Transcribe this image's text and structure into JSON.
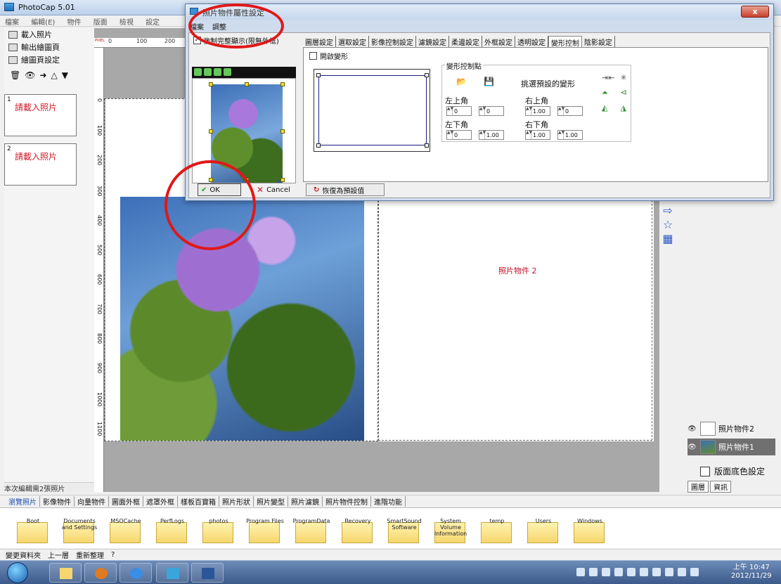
{
  "app": {
    "title": "PhotoCap 5.01"
  },
  "menu": {
    "items": [
      "檔案",
      "編輯(E)",
      "物件",
      "版面",
      "檢視",
      "設定"
    ]
  },
  "left": {
    "load_photo": "載入照片",
    "export_page": "輸出繪圖頁",
    "page_settings": "繪圖頁設定",
    "slots": [
      {
        "num": "1",
        "label": "請載入照片"
      },
      {
        "num": "2",
        "label": "請載入照片"
      }
    ],
    "status": "本次編輯需2張照片"
  },
  "canvas": {
    "ruler_units": "PIXEL",
    "h_ticks": [
      "0",
      "100",
      "200"
    ],
    "v_ticks": [
      "0",
      "100",
      "200",
      "300",
      "400",
      "500",
      "600",
      "700",
      "800",
      "900",
      "1000",
      "1100"
    ],
    "photo2_label": "照片物件 2"
  },
  "dialog": {
    "title": "照片物件屬性設定",
    "close": "x",
    "menu": [
      "檔案",
      "調整"
    ],
    "force_check": "強制完整顯示(限無外框)",
    "tabs": [
      "圖層設定",
      "選取設定",
      "影像控制設定",
      "濾鏡設定",
      "柔邊設定",
      "外框設定",
      "透明設定",
      "變形控制",
      "陰影設定"
    ],
    "active_tab": "變形控制",
    "enable_label": "開啟變形",
    "control_points_label": "變形控制點",
    "preset_label": "挑選預設的變形",
    "corners": {
      "top_left": {
        "label": "左上角",
        "x": "0",
        "y": "0"
      },
      "top_right": {
        "label": "右上角",
        "x": "1.00",
        "y": "0"
      },
      "bottom_left": {
        "label": "左下角",
        "x": "0",
        "y": "1.00"
      },
      "bottom_right": {
        "label": "右下角",
        "x": "1.00",
        "y": "1.00"
      }
    },
    "ok": "OK",
    "cancel": "Cancel",
    "restore": "恢復為預設值"
  },
  "right": {
    "layers": [
      {
        "name": "照片物件2",
        "selected": false
      },
      {
        "name": "照片物件1",
        "selected": true
      }
    ],
    "bg_color": "版面底色設定",
    "tabs": [
      "圖層",
      "資訊"
    ]
  },
  "bottom": {
    "tabs": [
      "瀏覽照片",
      "影像物件",
      "向量物件",
      "圖面外框",
      "遮罩外框",
      "樣板百寶箱",
      "照片形狀",
      "照片變型",
      "照片濾鏡",
      "照片物件控制",
      "進階功能"
    ],
    "folders": [
      "Boot",
      "Documents and Settings",
      "MSOCache",
      "PerfLogs",
      "photos",
      "Program Files",
      "ProgramData",
      "Recovery",
      "SmartSound Software",
      "System Volume Information",
      "temp",
      "Users",
      "Windows"
    ],
    "tools": [
      "變更資料夾",
      "上一層",
      "重新整理",
      "?"
    ]
  },
  "taskbar": {
    "time": "上午 10:47",
    "date": "2012/11/29"
  },
  "colors": {
    "accent": "#1d4fb3",
    "annotation": "#e01818",
    "red_text": "#d01a2a"
  }
}
